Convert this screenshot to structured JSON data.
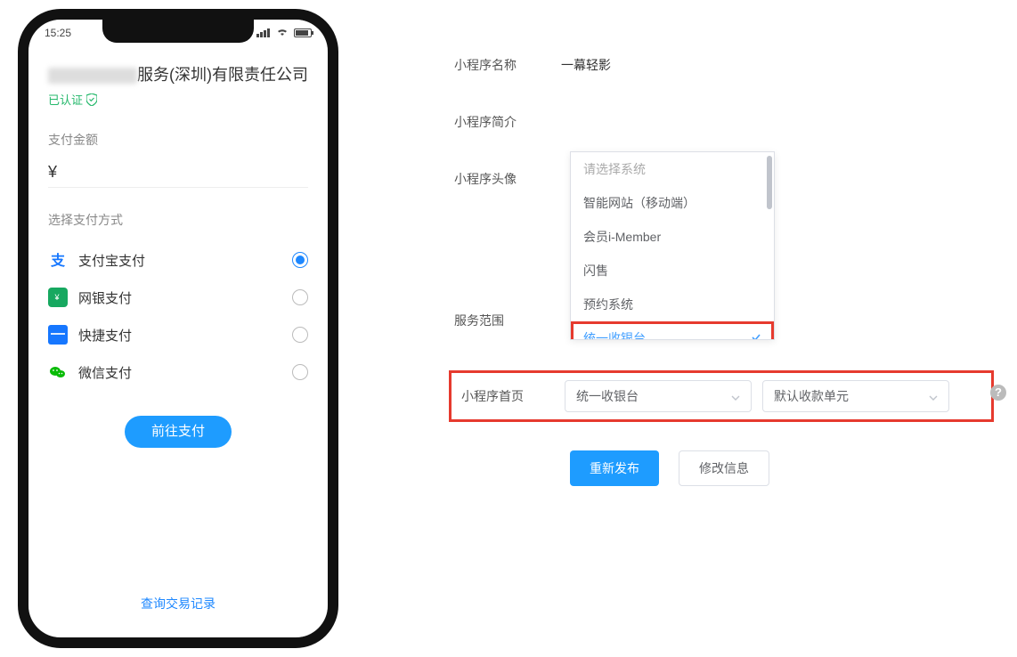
{
  "phone": {
    "status_time": "15:25",
    "company_suffix": "服务(深圳)有限责任公司",
    "verified_text": "已认证",
    "amount_label": "支付金额",
    "currency_symbol": "¥",
    "method_label": "选择支付方式",
    "methods": [
      {
        "label": "支付宝支付",
        "icon": "alipay",
        "checked": true
      },
      {
        "label": "网银支付",
        "icon": "union",
        "checked": false
      },
      {
        "label": "快捷支付",
        "icon": "quick",
        "checked": false
      },
      {
        "label": "微信支付",
        "icon": "wechat",
        "checked": false
      }
    ],
    "pay_button": "前往支付",
    "history_link": "查询交易记录"
  },
  "form": {
    "rows": {
      "name": {
        "label": "小程序名称",
        "value": "一幕轻影"
      },
      "intro": {
        "label": "小程序简介",
        "value": ""
      },
      "avatar": {
        "label": "小程序头像",
        "value": ""
      },
      "scope": {
        "label": "服务范围",
        "value": ""
      },
      "home": {
        "label": "小程序首页"
      }
    },
    "dropdown": {
      "placeholder": "请选择系统",
      "options": [
        "智能网站（移动端）",
        "会员i-Member",
        "闪售",
        "预约系统",
        "统一收银台"
      ],
      "selected": "统一收银台"
    },
    "home_select_1": "统一收银台",
    "home_select_2": "默认收款单元",
    "buttons": {
      "republish": "重新发布",
      "edit": "修改信息"
    },
    "help_tooltip": "?"
  },
  "colors": {
    "primary_blue": "#1e9cff",
    "highlight_red": "#e63a2e",
    "text_muted": "#888"
  }
}
